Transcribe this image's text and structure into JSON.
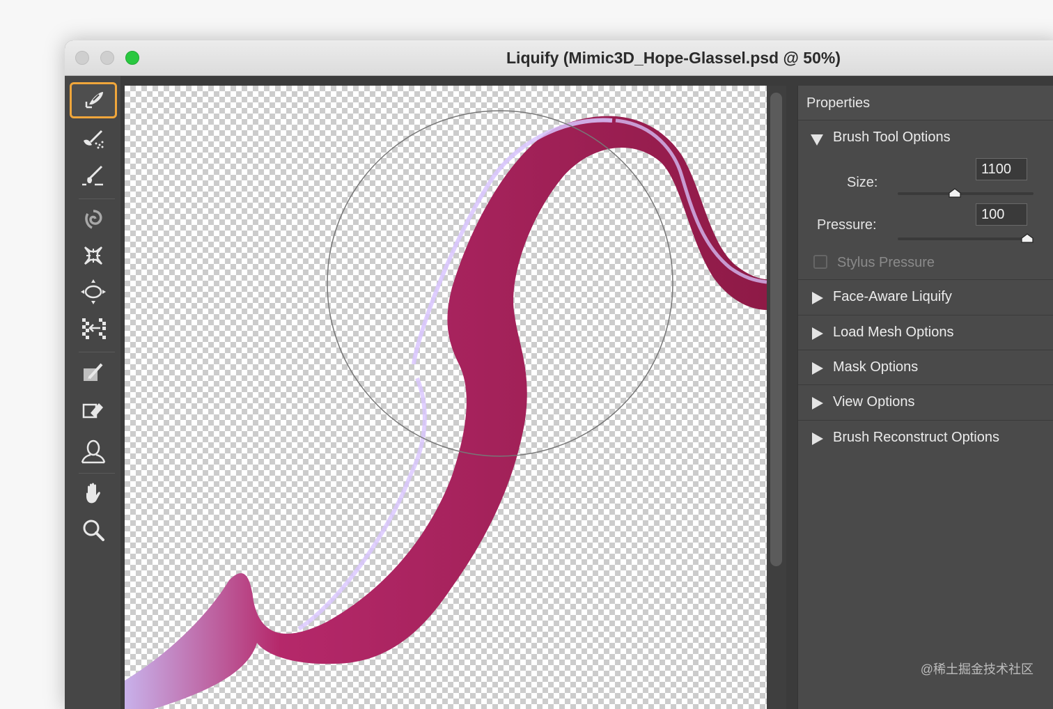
{
  "window": {
    "title": "Liquify (Mimic3D_Hope-Glassel.psd @ 50%)",
    "traffic_lights": [
      "close-disabled",
      "minimize-disabled",
      "zoom-green"
    ]
  },
  "tools": [
    {
      "name": "forward-warp-tool",
      "icon": "forward-warp-icon",
      "active": true
    },
    {
      "name": "reconstruct-tool",
      "icon": "reconstruct-icon",
      "active": false
    },
    {
      "name": "smooth-tool",
      "icon": "smooth-icon",
      "active": false
    },
    {
      "name": "twirl-clockwise-tool",
      "icon": "twirl-icon",
      "active": false
    },
    {
      "name": "pucker-tool",
      "icon": "pucker-icon",
      "active": false
    },
    {
      "name": "bloat-tool",
      "icon": "bloat-icon",
      "active": false
    },
    {
      "name": "push-left-tool",
      "icon": "push-left-icon",
      "active": false
    },
    {
      "name": "freeze-mask-tool",
      "icon": "freeze-mask-icon",
      "active": false
    },
    {
      "name": "thaw-mask-tool",
      "icon": "thaw-mask-icon",
      "active": false
    },
    {
      "name": "face-tool",
      "icon": "face-icon",
      "active": false
    },
    {
      "name": "hand-tool",
      "icon": "hand-icon",
      "active": false
    },
    {
      "name": "zoom-tool",
      "icon": "zoom-icon",
      "active": false
    }
  ],
  "properties": {
    "title": "Properties",
    "brush_tool_options": {
      "label": "Brush Tool Options",
      "size_label": "Size:",
      "size_value": "1100",
      "size_slider_fraction": 0.42,
      "pressure_label": "Pressure:",
      "pressure_value": "100",
      "pressure_slider_fraction": 1.0,
      "stylus_pressure_label": "Stylus Pressure",
      "stylus_pressure_checked": false
    },
    "sections": [
      {
        "label": "Face-Aware Liquify"
      },
      {
        "label": "Load Mesh Options"
      },
      {
        "label": "Mask Options"
      },
      {
        "label": "View Options"
      },
      {
        "label": "Brush Reconstruct Options"
      }
    ]
  },
  "watermark": "@稀土掘金技术社区",
  "colors": {
    "accent_active_tool": "#f0a63b",
    "stroke_dark": "#8e1a46",
    "stroke_mid": "#b5286a",
    "stroke_highlight": "#c9b7f0"
  }
}
